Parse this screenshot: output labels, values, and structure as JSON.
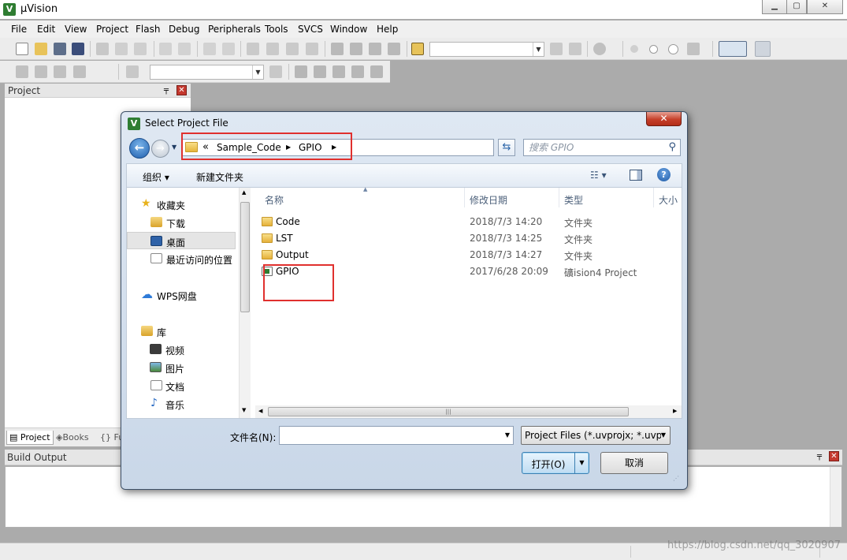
{
  "app": {
    "title": "µVision",
    "icon_text": "V"
  },
  "menu": [
    "File",
    "Edit",
    "View",
    "Project",
    "Flash",
    "Debug",
    "Peripherals",
    "Tools",
    "SVCS",
    "Window",
    "Help"
  ],
  "project_panel": {
    "title": "Project",
    "pin": "📌",
    "close": "✕"
  },
  "panel_tabs": [
    {
      "label": "Project",
      "icon": "project-icon"
    },
    {
      "label": "Books",
      "icon": "books-icon"
    },
    {
      "label": "{} Fu",
      "icon": "functions-icon"
    }
  ],
  "build_output": {
    "title": "Build Output"
  },
  "watermark": "https://blog.csdn.net/qq_3020907",
  "dialog": {
    "title": "Select Project File",
    "close": "✕",
    "breadcrumb": [
      "Sample_Code",
      "GPIO"
    ],
    "breadcrumb_prefix": "«",
    "search_placeholder": "搜索 GPIO",
    "commands": {
      "organize": "组织 ▾",
      "new_folder": "新建文件夹"
    },
    "nav": {
      "favorites": {
        "label": "收藏夹",
        "icon": "star-icon"
      },
      "items": [
        {
          "label": "下载",
          "icon": "download-icon"
        },
        {
          "label": "桌面",
          "icon": "desktop-icon"
        },
        {
          "label": "最近访问的位置",
          "icon": "recent-places-icon"
        }
      ],
      "wps": {
        "label": "WPS网盘",
        "icon": "cloud-icon"
      },
      "library": {
        "label": "库",
        "icon": "library-icon"
      },
      "library_items": [
        {
          "label": "视频",
          "icon": "video-icon"
        },
        {
          "label": "图片",
          "icon": "pictures-icon"
        },
        {
          "label": "文档",
          "icon": "documents-icon"
        },
        {
          "label": "音乐",
          "icon": "music-icon"
        }
      ]
    },
    "columns": [
      "名称",
      "修改日期",
      "类型",
      "大小"
    ],
    "files": [
      {
        "name": "Code",
        "date": "2018/7/3 14:20",
        "type": "文件夹",
        "icon": "folder-icon"
      },
      {
        "name": "LST",
        "date": "2018/7/3 14:25",
        "type": "文件夹",
        "icon": "folder-icon"
      },
      {
        "name": "Output",
        "date": "2018/7/3 14:27",
        "type": "文件夹",
        "icon": "folder-icon"
      },
      {
        "name": "GPIO",
        "date": "2017/6/28 20:09",
        "type": "礦ision4 Project",
        "icon": "uvision-project-icon"
      }
    ],
    "filename_label": "文件名(N):",
    "filename_value": "",
    "filter_value": "Project Files (*.uvprojx; *.uvp",
    "open_label": "打开(O)",
    "cancel_label": "取消"
  },
  "colors": {
    "highlight_box": "#e0302e",
    "dialog_frame": "#c9d7e8",
    "selected_nav": "#e5e5e5"
  }
}
